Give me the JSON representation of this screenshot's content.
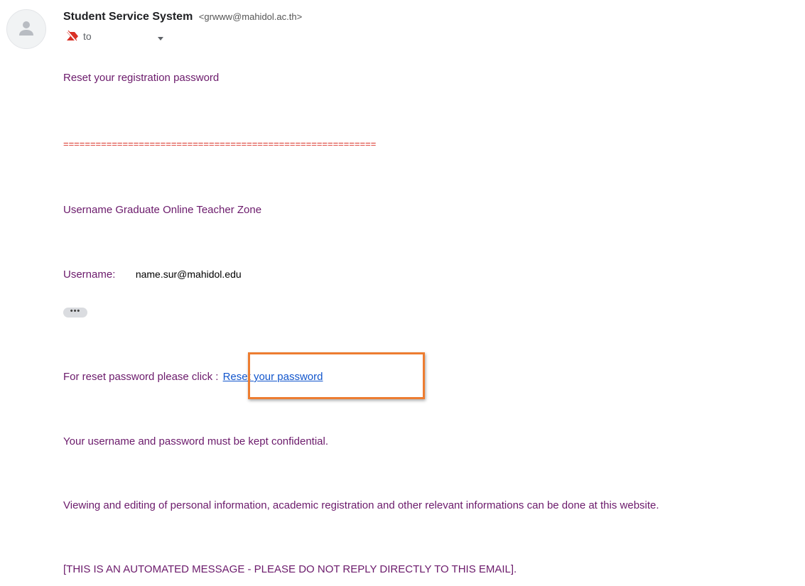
{
  "header": {
    "sender_name": "Student Service System",
    "sender_email": "<grwww@mahidol.ac.th>",
    "to_label": "to",
    "avatar_icon": "default-avatar-icon",
    "important_icon": "important-marker-icon",
    "dropdown_icon": "caret-down-icon"
  },
  "message": {
    "title_line": "Reset your registration password",
    "separator": "==========================================================",
    "zone_line": "Username Graduate Online Teacher Zone",
    "username_label": "Username:",
    "username_value": "name.sur@mahidol.edu",
    "expand_label": "•••",
    "reset_prompt": "For reset password please click :",
    "reset_link": "Reset your password",
    "confidential_line": "Your username and password must be kept confidential.",
    "info_line": "Viewing and editing of personal information, academic registration and other relevant informations can be done at this website.",
    "automated_line": "[THIS IS AN AUTOMATED MESSAGE - PLEASE DO NOT REPLY DIRECTLY TO THIS EMAIL]."
  },
  "colors": {
    "body_text": "#6b1a6b",
    "link": "#1155cc",
    "separator": "#d93025",
    "highlight": "#ed7d31"
  }
}
